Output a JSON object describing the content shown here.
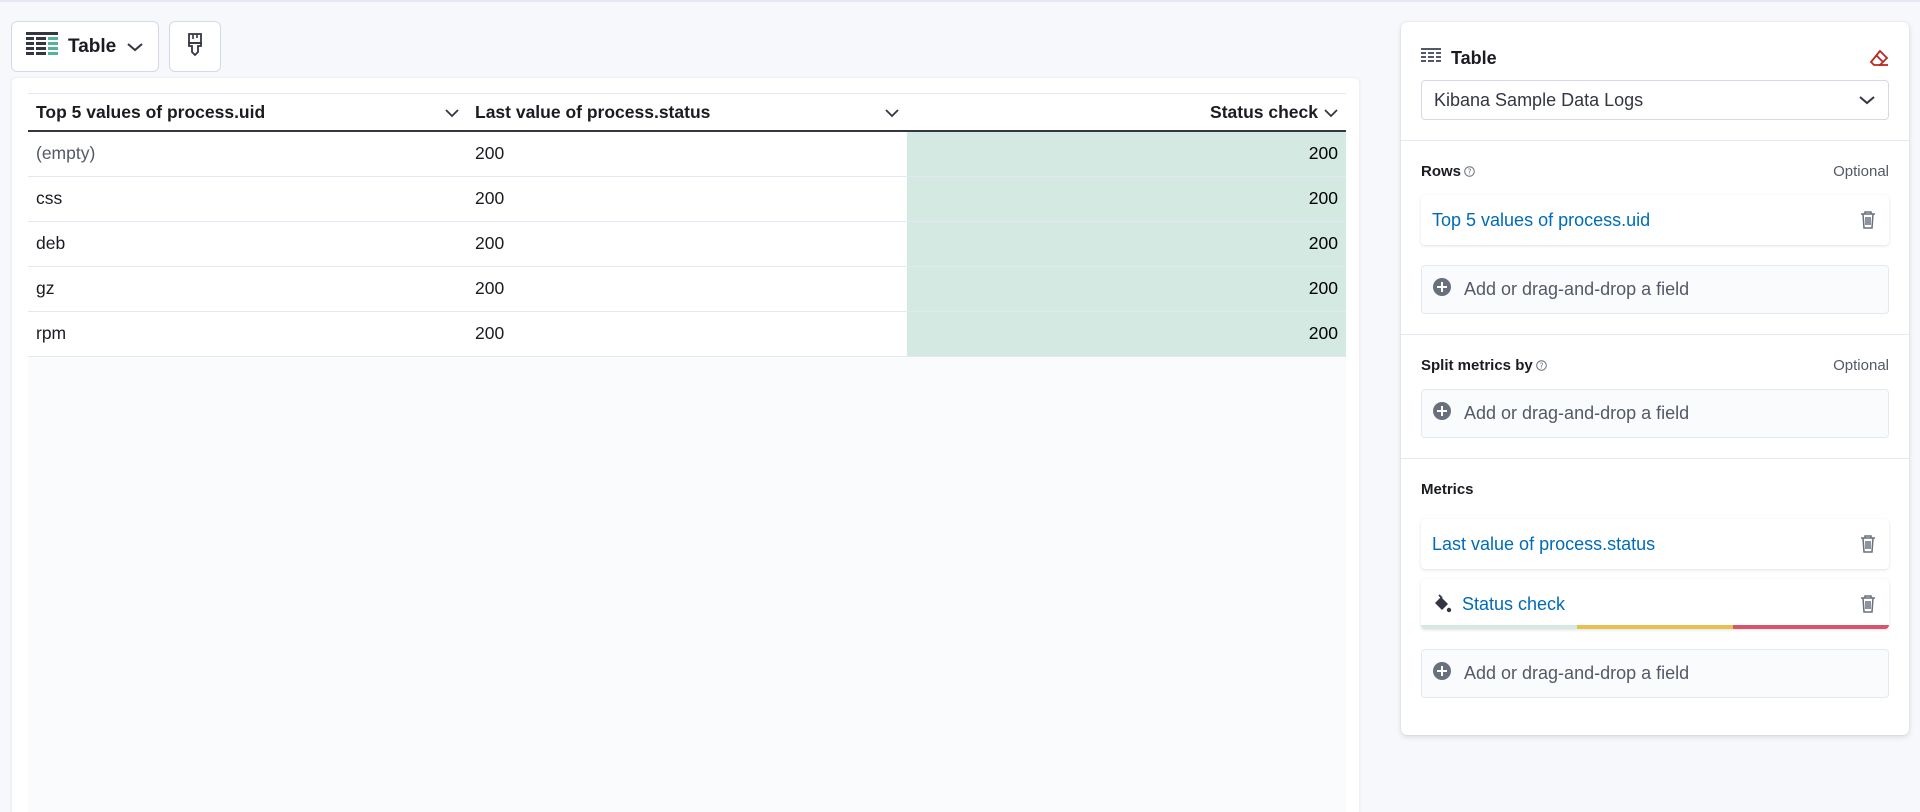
{
  "toolbar": {
    "chart_type_label": "Table",
    "chart_type_icon": "table-icon",
    "palette_icon": "paintbrush-icon"
  },
  "table": {
    "columns": [
      {
        "label": "Top 5 values of process.uid"
      },
      {
        "label": "Last value of process.status"
      },
      {
        "label": "Status check"
      }
    ],
    "rows": [
      {
        "uid": "(empty)",
        "status": "200",
        "check": "200"
      },
      {
        "uid": "css",
        "status": "200",
        "check": "200"
      },
      {
        "uid": "deb",
        "status": "200",
        "check": "200"
      },
      {
        "uid": "gz",
        "status": "200",
        "check": "200"
      },
      {
        "uid": "rpm",
        "status": "200",
        "check": "200"
      }
    ],
    "status_cell_color": "#d4e9e2"
  },
  "panel": {
    "title": "Table",
    "datasource": "Kibana Sample Data Logs",
    "rows_section": {
      "title": "Rows",
      "optional": "Optional",
      "item": "Top 5 values of process.uid",
      "add": "Add or drag-and-drop a field"
    },
    "split_section": {
      "title": "Split metrics by",
      "optional": "Optional",
      "add": "Add or drag-and-drop a field"
    },
    "metrics_section": {
      "title": "Metrics",
      "item1": "Last value of process.status",
      "item2": "Status check",
      "add": "Add or drag-and-drop a field",
      "palette_colors": [
        "#d4e9e2",
        "#e6c150",
        "#d6556d"
      ]
    }
  },
  "colors": {
    "link": "#006bb8",
    "eraser": "#bd271e"
  }
}
